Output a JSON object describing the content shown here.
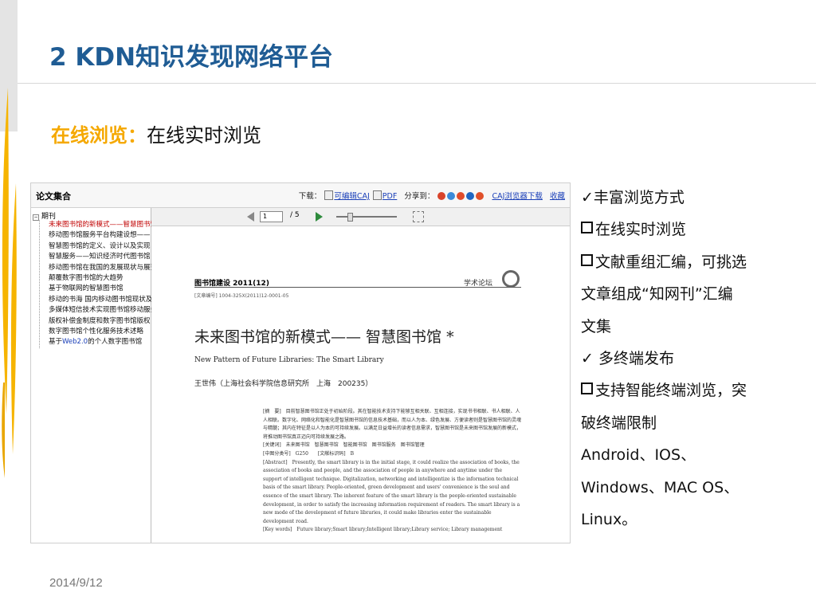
{
  "slide": {
    "title": "2 KDN知识发现网络平台",
    "subtitle_highlight": "在线浏览：",
    "subtitle_text": "在线实时浏览",
    "date": "2014/9/12"
  },
  "screenshot": {
    "collection_title": "论文集合",
    "toolbar": {
      "download_label": "下载：",
      "caj_link": "可编辑CAJ",
      "pdf_link": "PDF",
      "share_label": "分享到：",
      "caj_browser_link": "CAJ浏览器下载",
      "favorite_link": "收藏"
    },
    "tree_root": "期刊",
    "tree_items": [
      "未来图书馆的新模式——智慧图书馆",
      "移动图书馆服务平台构建设想——",
      "智慧图书馆的定义、设计以及实现",
      "智慧服务——知识经济时代图书馆",
      "移动图书馆在我国的发展现状与展望",
      "颠覆数字图书馆的大趋势",
      "基于物联网的智慧图书馆",
      "移动的书海 国内移动图书馆现状及",
      "多媒体短信技术实现图书馆移动服务",
      "版权补偿金制度和数字图书馆版权",
      "数字图书馆个性化服务技术述略"
    ],
    "tree_last_prefix": "基于",
    "tree_last_blue": "Web2.0",
    "tree_last_suffix": "的个人数字图书馆",
    "viewer": {
      "page_input": "1",
      "page_total": "/ 5"
    },
    "paper": {
      "journal": "图书馆建设 2011(12)",
      "category": "学术论坛",
      "issn": "[文章编号] 1004-325X(2011)12-0001-05",
      "title_cn": "未来图书馆的新模式—— 智慧图书馆 *",
      "title_en": "New Pattern of Future Libraries: The Smart Library",
      "author": "王世伟（上海社会科学院信息研究所　上海　200235）",
      "abstract_lines": [
        "[摘　要]　目前智慧图书馆正处于初始阶段。其在智能技术支持下能够互相关联、互相连接，实现书书相联、书人相联、人人相联。数字化、网络化和智能化是智慧图书馆的信息技术基础，而以人为本、绿色发展、方便读者则是智慧图书馆的灵魂与精髓；其内在特征是以人为本的可持续发展。以满足日益增长的读者信息需求，智慧图书馆是未来图书馆发展的新模式，将推动图书馆真正迈向可持续发展之路。",
        "[关键词]　未来图书馆　智慧图书馆　智能图书馆　图书馆服务　图书馆管理",
        "[中图分类号]　G250　　[文献标识码]　B",
        "[Abstract]　Presently, the smart library is in the initial stage, it could realize the association of books, the association of books and people, and the association of people in anywhere and anytime under the support of intelligent technique. Digitalization, networking and intelligentize is the information technical basis of the smart library. People-oriented, green development and users' convenience is the soul and essence of the smart library. The inherent feature of the smart library is the people-oriented sustainable development, in order to satisfy the increasing information requirement of readers. The smart library is a new mode of the development of future libraries, it could make libraries enter the sustainable development road.",
        "[Key words]　Future library;Smart library;Intelligent library;Library service; Library management"
      ]
    }
  },
  "bullets": [
    {
      "marker": "check",
      "text": "丰富浏览方式"
    },
    {
      "marker": "square",
      "text": "在线实时浏览"
    },
    {
      "marker": "square",
      "text": "文献重组汇编，可挑选"
    },
    {
      "marker": "none",
      "text": "文章组成“知网刊”汇编"
    },
    {
      "marker": "none",
      "text": "文集"
    },
    {
      "marker": "check",
      "text": " 多终端发布"
    },
    {
      "marker": "square",
      "text": "支持智能终端浏览，突"
    },
    {
      "marker": "none",
      "text": "破终端限制"
    },
    {
      "marker": "none",
      "text": "Android、IOS、"
    },
    {
      "marker": "none",
      "text": "Windows、MAC OS、"
    },
    {
      "marker": "none",
      "text": "Linux。"
    }
  ],
  "colors": {
    "title": "#1f5c94",
    "highlight": "#f5a800",
    "link": "#1a3fb8",
    "active_item": "#c00000"
  }
}
